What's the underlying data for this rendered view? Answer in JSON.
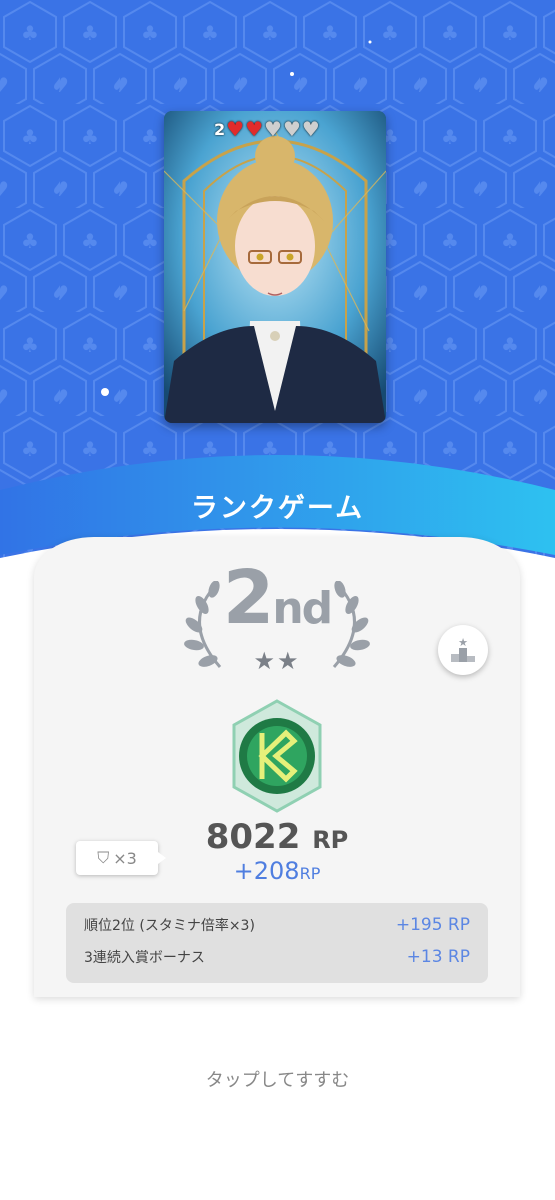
{
  "card": {
    "lives_count": "2",
    "hearts_filled": 2,
    "hearts_total": 5
  },
  "header": {
    "title": "ランクゲーム"
  },
  "result": {
    "place_number": "2",
    "place_suffix": "nd",
    "stars": "★★",
    "shield_label": "×3",
    "rp_total": "8022",
    "rp_total_unit": "RP",
    "rp_gain": "+208",
    "rp_gain_unit": "RP",
    "breakdown": [
      {
        "label": "順位2位 (スタミナ倍率×3)",
        "value": "+195 RP"
      },
      {
        "label": "3連続入賞ボーナス",
        "value": "+13 RP"
      }
    ]
  },
  "footer": {
    "tap_hint": "タップしてすすむ"
  },
  "colors": {
    "background_blue": "#3a73e6",
    "accent_blue": "#4f7ee0",
    "panel": "#f5f5f5"
  }
}
